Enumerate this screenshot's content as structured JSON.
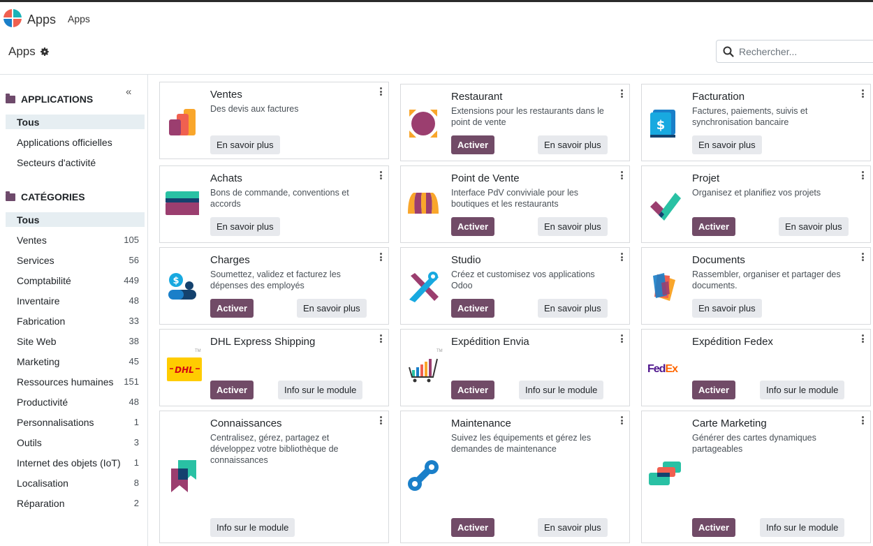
{
  "navbar": {
    "app_name": "Apps",
    "menu_item": "Apps"
  },
  "control_panel": {
    "title": "Apps",
    "search_placeholder": "Rechercher..."
  },
  "sidebar": {
    "applications_title": "APPLICATIONS",
    "applications": [
      {
        "label": "Tous",
        "active": true
      },
      {
        "label": "Applications officielles"
      },
      {
        "label": "Secteurs d'activité"
      }
    ],
    "categories_title": "CATÉGORIES",
    "categories": [
      {
        "label": "Tous",
        "count": "",
        "active": true
      },
      {
        "label": "Ventes",
        "count": "105"
      },
      {
        "label": "Services",
        "count": "56"
      },
      {
        "label": "Comptabilité",
        "count": "449"
      },
      {
        "label": "Inventaire",
        "count": "48"
      },
      {
        "label": "Fabrication",
        "count": "33"
      },
      {
        "label": "Site Web",
        "count": "38"
      },
      {
        "label": "Marketing",
        "count": "45"
      },
      {
        "label": "Ressources humaines",
        "count": "151"
      },
      {
        "label": "Productivité",
        "count": "48"
      },
      {
        "label": "Personnalisations",
        "count": "1"
      },
      {
        "label": "Outils",
        "count": "3"
      },
      {
        "label": "Internet des objets (IoT)",
        "count": "1"
      },
      {
        "label": "Localisation",
        "count": "8"
      },
      {
        "label": "Réparation",
        "count": "2"
      }
    ]
  },
  "cards": [
    {
      "title": "Ventes",
      "desc": "Des devis aux factures",
      "icon": "sales-icon",
      "primary": "",
      "secondary": "En savoir plus"
    },
    {
      "title": "Restaurant",
      "desc": "Extensions pour les restaurants dans le point de vente",
      "icon": "restaurant-icon",
      "primary": "Activer",
      "secondary": "En savoir plus"
    },
    {
      "title": "Facturation",
      "desc": "Factures, paiements, suivis et synchronisation bancaire",
      "icon": "invoicing-icon",
      "primary": "",
      "secondary": "En savoir plus"
    },
    {
      "title": "Achats",
      "desc": "Bons de commande, conventions et accords",
      "icon": "purchase-icon",
      "primary": "",
      "secondary": "En savoir plus"
    },
    {
      "title": "Point de Vente",
      "desc": "Interface PdV conviviale pour les boutiques et les restaurants",
      "icon": "point-of-sale-icon",
      "primary": "Activer",
      "secondary": "En savoir plus"
    },
    {
      "title": "Projet",
      "desc": "Organisez et planifiez vos projets",
      "icon": "project-icon",
      "primary": "Activer",
      "secondary": "En savoir plus"
    },
    {
      "title": "Charges",
      "desc": "Soumettez, validez et facturez les dépenses des employés",
      "icon": "expenses-icon",
      "primary": "Activer",
      "secondary": "En savoir plus"
    },
    {
      "title": "Studio",
      "desc": "Créez et customisez vos applications Odoo",
      "icon": "studio-icon",
      "primary": "Activer",
      "secondary": "En savoir plus"
    },
    {
      "title": "Documents",
      "desc": "Rassembler, organiser et partager des documents.",
      "icon": "documents-icon",
      "primary": "",
      "secondary": "En savoir plus"
    },
    {
      "title": "DHL Express Shipping",
      "desc": "",
      "icon": "dhl-logo-icon",
      "primary": "Activer",
      "secondary": "Info sur le module"
    },
    {
      "title": "Expédition Envia",
      "desc": "",
      "icon": "envia-logo-icon",
      "primary": "Activer",
      "secondary": "Info sur le module"
    },
    {
      "title": "Expédition Fedex",
      "desc": "",
      "icon": "fedex-logo-icon",
      "primary": "Activer",
      "secondary": "Info sur le module"
    },
    {
      "title": "Connaissances",
      "desc": "Centralisez, gérez, partagez et développez votre bibliothèque de connaissances",
      "icon": "knowledge-icon",
      "primary": "",
      "secondary": "Info sur le module"
    },
    {
      "title": "Maintenance",
      "desc": "Suivez les équipements et gérez les demandes de maintenance",
      "icon": "maintenance-icon",
      "primary": "Activer",
      "secondary": "En savoir plus"
    },
    {
      "title": "Carte Marketing",
      "desc": "Générer des cartes dynamiques partageables",
      "icon": "marketing-card-icon",
      "primary": "Activer",
      "secondary": "Info sur le module"
    }
  ],
  "logos": {
    "dhl": "DHL",
    "fedex_fed": "Fed",
    "fedex_ex": "Ex",
    "trademark": "TM"
  },
  "colors": {
    "primary": "#714b67",
    "secondary_btn": "#e7e9ed",
    "active_bg": "#e6eef2"
  }
}
